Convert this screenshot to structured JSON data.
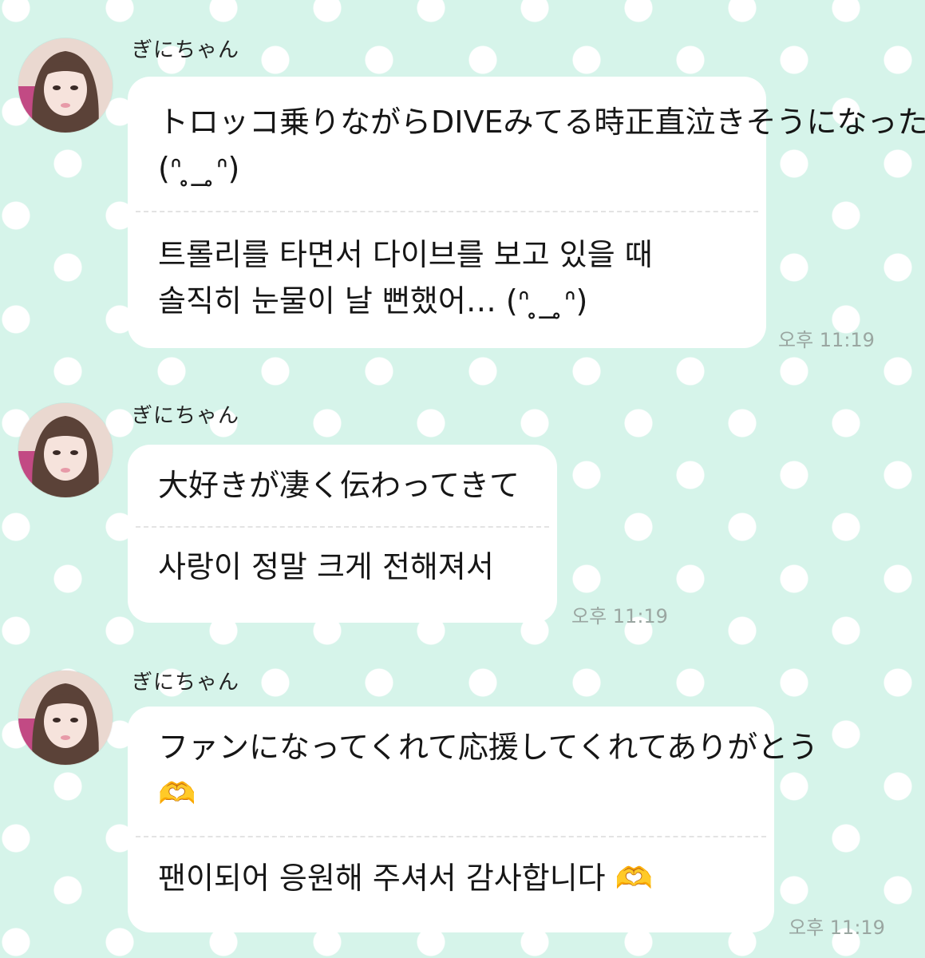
{
  "messages": [
    {
      "sender": "ぎにちゃん",
      "original": "トロッコ乗りながらDIVEみてる時正直泣きそうになった…(ᐢ ̥_ ̥ᐢ)",
      "translation": "트롤리를 타면서 다이브를 보고 있을 때 솔직히 눈물이 날 뻔했어… (ᐢ ̥_ ̥ᐢ)",
      "time": "오후 11:19"
    },
    {
      "sender": "ぎにちゃん",
      "original": "大好きが凄く伝わってきて",
      "translation": "사랑이 정말 크게 전해져서",
      "time": "오후 11:19"
    },
    {
      "sender": "ぎにちゃん",
      "original": "ファンになってくれて応援してくれてありがとう🫶",
      "translation": "팬이되어 응원해 주셔서 감사합니다 🫶",
      "time": "오후 11:19"
    }
  ],
  "colors": {
    "background": "#d6f4ea",
    "dots": "#ffffff",
    "bubble": "#ffffff",
    "timestamp": "#9aa6a1"
  }
}
